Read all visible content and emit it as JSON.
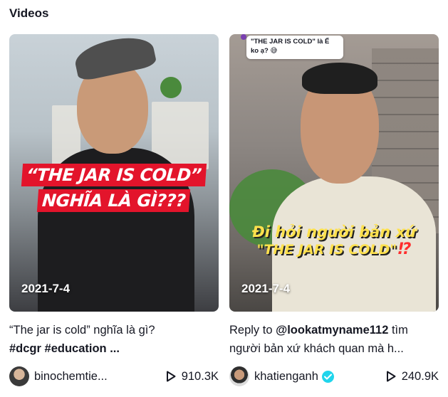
{
  "section": {
    "title": "Videos"
  },
  "videos": [
    {
      "overlay_lines": [
        "“THE JAR IS COLD”",
        "NGHĨA LÀ GÌ???"
      ],
      "date": "2021-7-4",
      "desc_text": "“The jar is cold” nghĩa là gì?",
      "hashtags": "#dcgr #education ...",
      "author": "binochemtie...",
      "views": "910.3K"
    },
    {
      "comment": "\"THE JAR IS COLD\" là Ế ko ạ? 😅",
      "overlay_line1": "Đi hỏi người bản xứ",
      "overlay_line2": "\"THE JAR IS COLD\"",
      "overlay_excl": "⁉",
      "date": "2021-7-4",
      "desc_prefix": "Reply to ",
      "desc_mention": "@lookatmyname112",
      "desc_suffix": " tìm người bản xứ khách quan mà h...",
      "author": "khatienganh",
      "views": "240.9K"
    }
  ],
  "icons": {
    "play": "play-icon",
    "verified": "verified-badge-icon",
    "verified_color": "#20d5ec"
  }
}
